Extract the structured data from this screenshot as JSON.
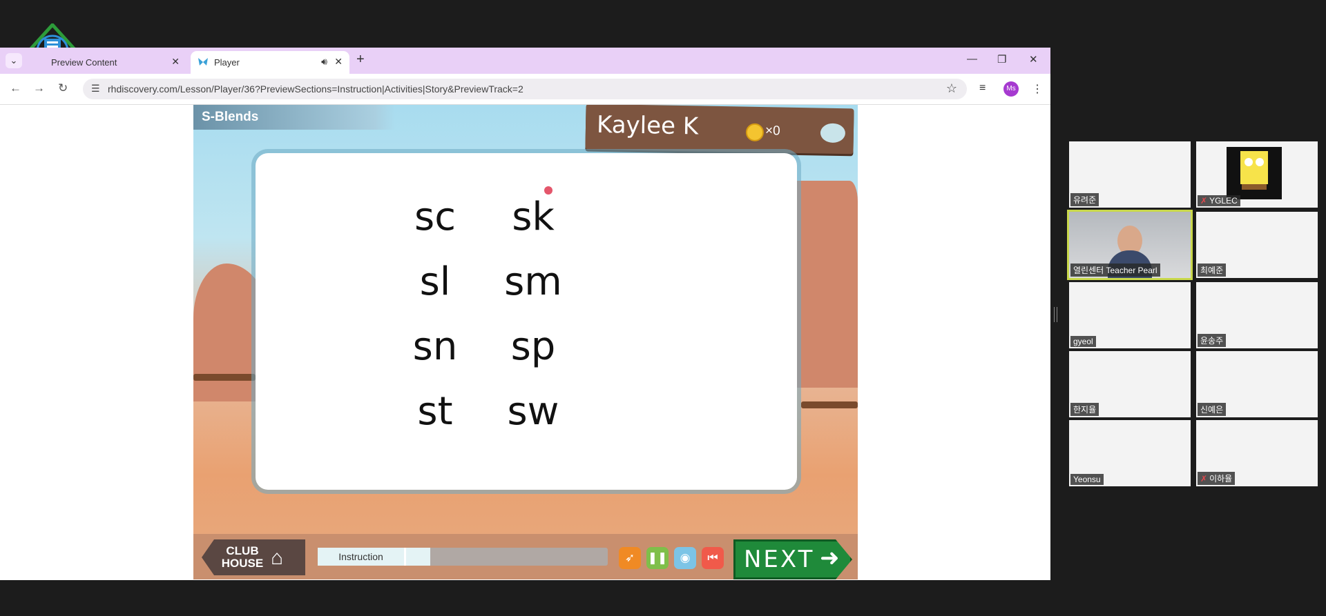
{
  "browser": {
    "tabs": [
      {
        "title": "Preview Content",
        "active": false
      },
      {
        "title": "Player",
        "active": true
      }
    ],
    "url": "rhdiscovery.com/Lesson/Player/36?PreviewSections=Instruction|Activities|Story&PreviewTrack=2",
    "profile_initials": "Ms"
  },
  "game": {
    "lesson_title": "S-Blends",
    "student_name": "Kaylee K",
    "coin_count": "×0",
    "blends": [
      "sc",
      "sk",
      "sl",
      "sm",
      "sn",
      "sp",
      "st",
      "sw"
    ],
    "club_house_label": "CLUB HOUSE",
    "progress_label": "Instruction",
    "progress_fraction": 0.12,
    "next_label": "NEXT"
  },
  "participants": [
    {
      "name": "유려준",
      "muted": false
    },
    {
      "name": "YGLEC",
      "muted": true
    },
    {
      "name": "열린센터 Teacher Pearl",
      "muted": false,
      "speaking": true
    },
    {
      "name": "최예준",
      "muted": false
    },
    {
      "name": "gyeol",
      "muted": false
    },
    {
      "name": "윤송주",
      "muted": false
    },
    {
      "name": "한지율",
      "muted": false
    },
    {
      "name": "신예은",
      "muted": false
    },
    {
      "name": "Yeonsu",
      "muted": false
    },
    {
      "name": "이하율",
      "muted": true
    }
  ],
  "colors": {
    "tabstrip": "#e9d0f7",
    "next_green": "#1f8a3a",
    "sign_brown": "#7d5540",
    "speaking_outline": "#c9d84b"
  }
}
